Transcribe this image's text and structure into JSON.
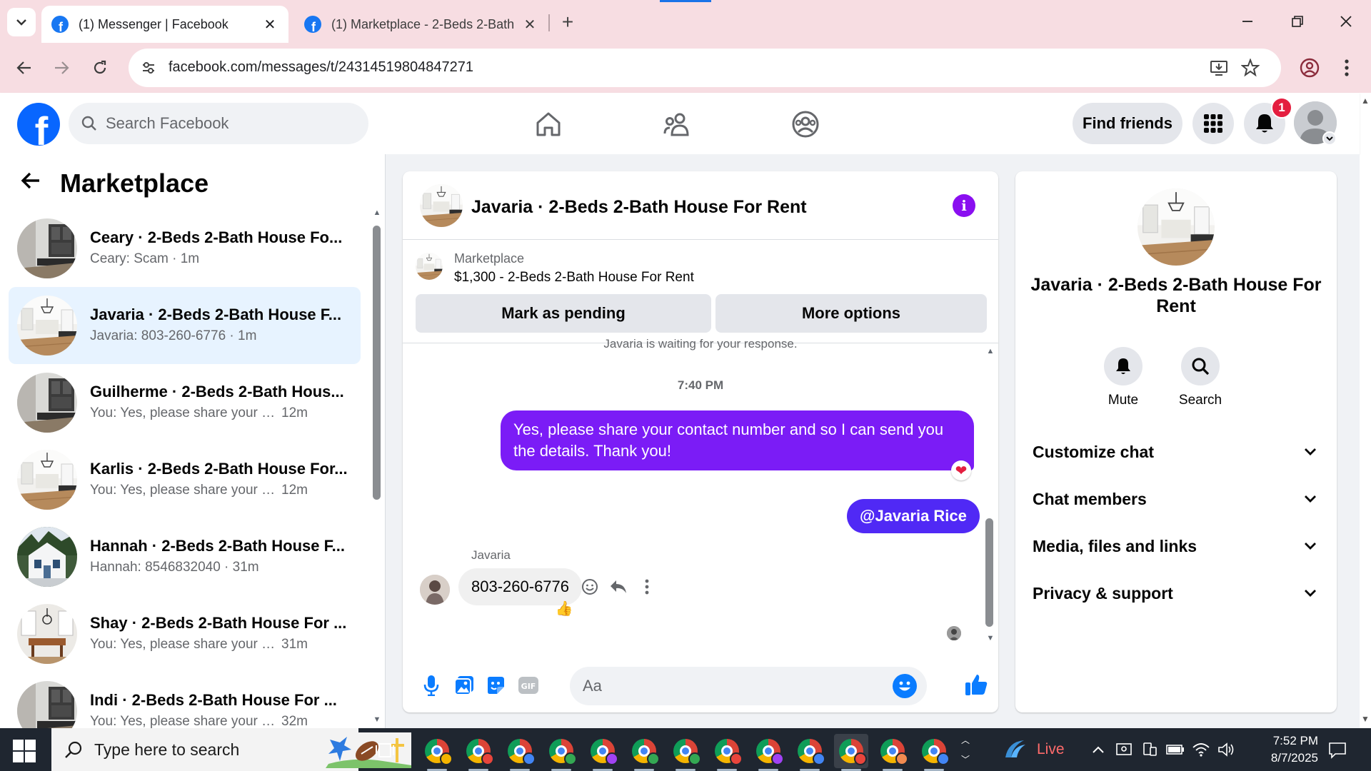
{
  "browser": {
    "tabs": [
      {
        "title": "(1) Messenger | Facebook",
        "active": true
      },
      {
        "title": "(1) Marketplace - 2-Beds 2-Bath",
        "active": false
      }
    ],
    "url": "facebook.com/messages/t/24314519804847271"
  },
  "fb": {
    "search_placeholder": "Search Facebook",
    "find_friends": "Find friends",
    "notification_count": "1",
    "brand_color": "#0866ff"
  },
  "sidebar": {
    "title": "Marketplace",
    "chats": [
      {
        "name": "Ceary · 2-Beds 2-Bath House Fo...",
        "preview": "Ceary: Scam · 1m",
        "time": "",
        "active": false,
        "thumb": "interior-dark"
      },
      {
        "name": "Javaria · 2-Beds 2-Bath House F...",
        "preview": "Javaria: 803-260-6776 · 1m",
        "time": "",
        "active": true,
        "thumb": "interior-bright"
      },
      {
        "name": "Guilherme · 2-Beds 2-Bath Hous...",
        "preview": "You: Yes, please share your conta...",
        "time": "12m",
        "active": false,
        "thumb": "interior-dark"
      },
      {
        "name": "Karlis · 2-Beds 2-Bath House For...",
        "preview": "You: Yes, please share your conta...",
        "time": "12m",
        "active": false,
        "thumb": "interior-bright"
      },
      {
        "name": "Hannah · 2-Beds 2-Bath House F...",
        "preview": "Hannah: 8546832040 · 31m",
        "time": "",
        "active": false,
        "thumb": "house-exterior"
      },
      {
        "name": "Shay · 2-Beds 2-Bath House For ...",
        "preview": "You: Yes, please share your conta...",
        "time": "31m",
        "active": false,
        "thumb": "dining-room"
      },
      {
        "name": "Indi · 2-Beds 2-Bath House For ...",
        "preview": "You: Yes, please share your conta...",
        "time": "32m",
        "active": false,
        "thumb": "interior-dark"
      }
    ]
  },
  "conversation": {
    "title": "Javaria · 2-Beds 2-Bath House For Rent",
    "listing_label": "Marketplace",
    "listing_price_title": "$1,300 - 2-Beds 2-Bath House For Rent",
    "mark_pending": "Mark as pending",
    "more_options": "More options",
    "waiting_note": "Javaria is waiting for your response.",
    "timestamp": "7:40 PM",
    "messages": {
      "out_1": "Yes, please share your contact number and so I can send you the details. Thank you!",
      "out_2": "@Javaria Rice",
      "in_sender": "Javaria",
      "in_1": "803-260-6776"
    },
    "input_placeholder": "Aa",
    "accent_color": "#7b1cf6"
  },
  "info_panel": {
    "title": "Javaria · 2-Beds 2-Bath House For Rent",
    "actions": [
      "Mute",
      "Search"
    ],
    "sections": [
      "Customize chat",
      "Chat members",
      "Media, files and links",
      "Privacy & support"
    ]
  },
  "taskbar": {
    "search_placeholder": "Type here to search",
    "live_label": "Live",
    "time": "7:52 PM",
    "date": "8/7/2025",
    "profile_colors": [
      "#f4b400",
      "#e8453c",
      "#4285f4",
      "#34a853",
      "#a142f4",
      "#34a853",
      "#34a853",
      "#e8453c",
      "#a142f4",
      "#4285f4",
      "#e8453c",
      "#f28b50",
      "#4285f4"
    ]
  }
}
